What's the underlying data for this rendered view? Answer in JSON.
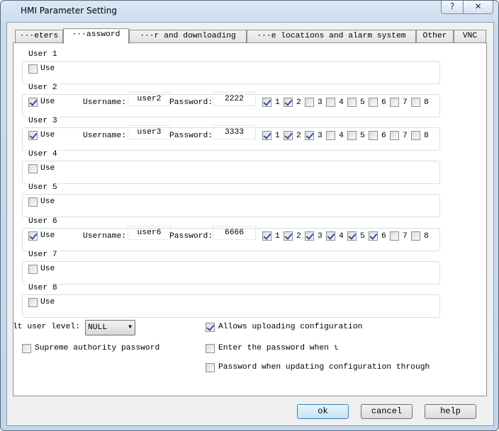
{
  "window": {
    "title": "HMI Parameter Setting",
    "help_icon": "?",
    "close_icon": "✕"
  },
  "tabs": [
    "···eters",
    "···assword",
    "···r and downloading",
    "···e locations and alarm system",
    "Other",
    "VNC"
  ],
  "selected_tab": 1,
  "labels": {
    "use": "Use",
    "username": "Username:",
    "password": "Password:"
  },
  "users": [
    {
      "title": "User 1",
      "use": false
    },
    {
      "title": "User 2",
      "use": true,
      "username": "user2",
      "password": "2222",
      "levels": [
        true,
        true,
        false,
        false,
        false,
        false,
        false,
        false
      ]
    },
    {
      "title": "User 3",
      "use": true,
      "username": "user3",
      "password": "3333",
      "levels": [
        true,
        true,
        true,
        false,
        false,
        false,
        false,
        false
      ]
    },
    {
      "title": "User 4",
      "use": false
    },
    {
      "title": "User 5",
      "use": false
    },
    {
      "title": "User 6",
      "use": true,
      "username": "user6",
      "password": "6666",
      "levels": [
        true,
        true,
        true,
        true,
        true,
        true,
        false,
        false
      ]
    },
    {
      "title": "User 7",
      "use": false
    },
    {
      "title": "User 8",
      "use": false
    }
  ],
  "level_labels": [
    "1",
    "2",
    "3",
    "4",
    "5",
    "6",
    "7",
    "8"
  ],
  "default_level": {
    "label": "lt user level:",
    "value": "NULL"
  },
  "options": {
    "supreme": {
      "label": "Supreme authority password",
      "checked": false
    },
    "allow_upload": {
      "label": "Allows uploading configuration",
      "checked": true
    },
    "enter_password": {
      "label": "Enter the password when ι",
      "checked": false
    },
    "password_update": {
      "label": "Password when updating configuration through",
      "checked": false
    }
  },
  "buttons": {
    "ok": "ok",
    "cancel": "cancel",
    "help": "help"
  }
}
